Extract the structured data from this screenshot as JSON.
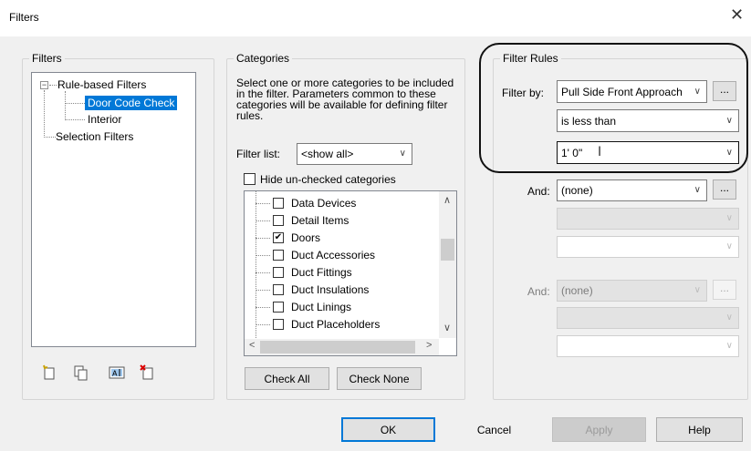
{
  "window": {
    "title": "Filters",
    "close_glyph": "✕"
  },
  "filters_group": {
    "label": "Filters",
    "tree": [
      {
        "label": "Rule-based Filters",
        "expander": "−"
      },
      {
        "label": "Door Code Check",
        "selected": true
      },
      {
        "label": "Interior"
      },
      {
        "label": "Selection Filters"
      }
    ],
    "icons": [
      "new-filter-icon",
      "duplicate-filter-icon",
      "rename-filter-icon",
      "delete-filter-icon"
    ]
  },
  "categories_group": {
    "label": "Categories",
    "description": "Select one or more categories to be included in the filter.  Parameters common to these categories will be available for defining filter rules.",
    "filter_list_label": "Filter list:",
    "filter_list_value": "<show all>",
    "hide_unchecked_label": "Hide un-checked categories",
    "hide_unchecked_checked": false,
    "items": [
      {
        "label": "Data Devices",
        "checked": false
      },
      {
        "label": "Detail Items",
        "checked": false
      },
      {
        "label": "Doors",
        "checked": true
      },
      {
        "label": "Duct Accessories",
        "checked": false
      },
      {
        "label": "Duct Fittings",
        "checked": false
      },
      {
        "label": "Duct Insulations",
        "checked": false
      },
      {
        "label": "Duct Linings",
        "checked": false
      },
      {
        "label": "Duct Placeholders",
        "checked": false
      }
    ],
    "check_mark": "✔",
    "check_all_label": "Check All",
    "check_none_label": "Check None"
  },
  "filter_rules_group": {
    "label": "Filter Rules",
    "filter_by_label": "Filter by:",
    "filter_by_value": "Pull Side Front Approach",
    "operator_value": "is less than",
    "rule_value": "1' 0\"",
    "and_label_1": "And:",
    "and_value_1": "(none)",
    "and_label_2": "And:",
    "and_value_2": "(none)",
    "ellipsis": "..."
  },
  "footer": {
    "ok_label": "OK",
    "cancel_label": "Cancel",
    "apply_label": "Apply",
    "help_label": "Help"
  },
  "colors": {
    "selection": "#0078d7",
    "default_button_border": "#0078d7",
    "highlight_ring": "#111111"
  }
}
